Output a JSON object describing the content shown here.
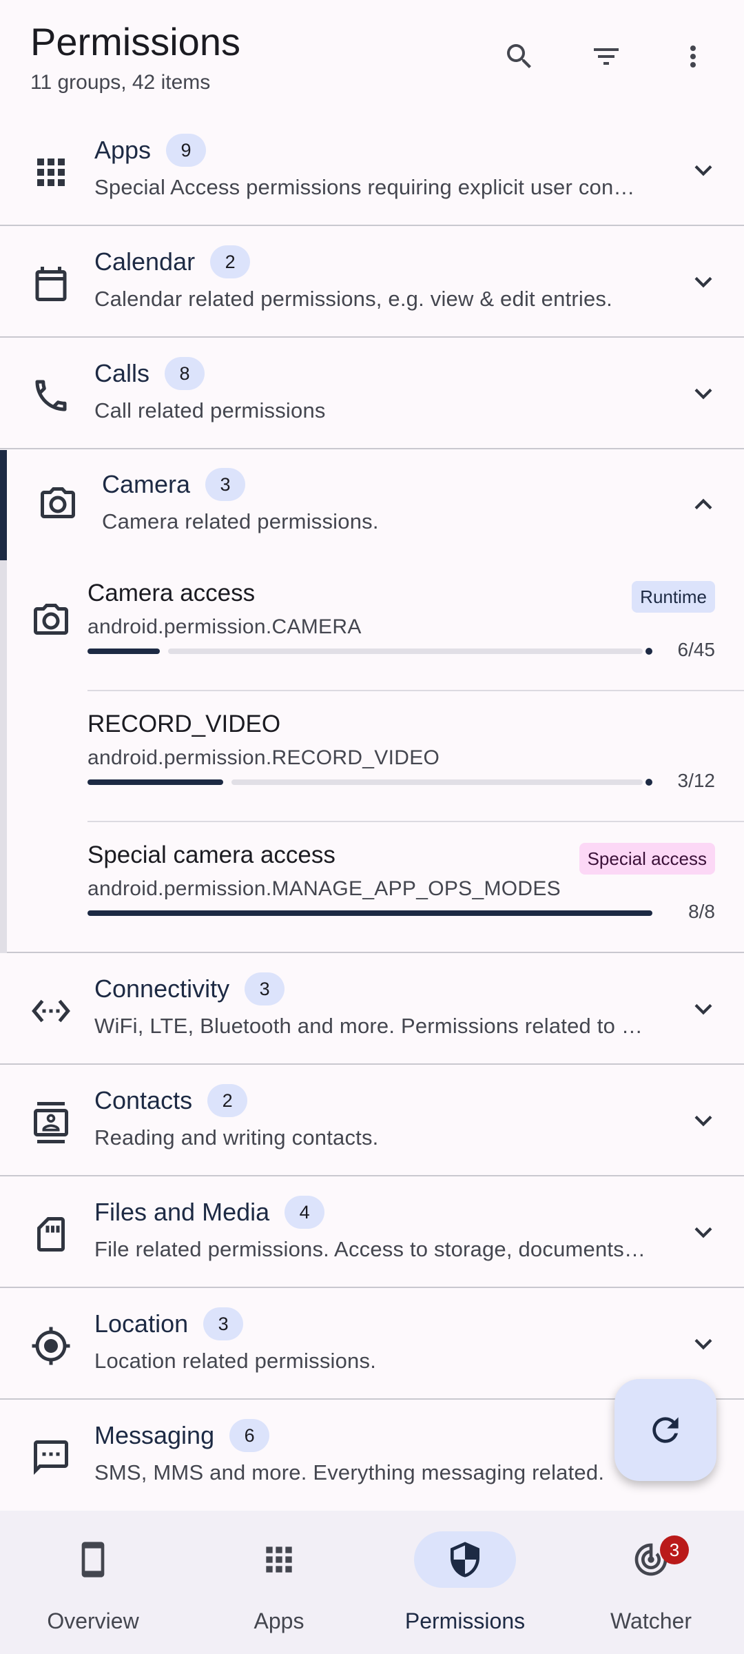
{
  "header": {
    "title": "Permissions",
    "subtitle": "11 groups, 42 items",
    "actions": [
      "search-icon",
      "filter-icon",
      "more-vert-icon"
    ]
  },
  "groups": [
    {
      "name": "Apps",
      "count": "9",
      "description": "Special Access permissions requiring explicit user consent",
      "icon": "apps-grid-icon",
      "expanded": false
    },
    {
      "name": "Calendar",
      "count": "2",
      "description": "Calendar related permissions, e.g. view & edit entries.",
      "icon": "calendar-icon",
      "expanded": false
    },
    {
      "name": "Calls",
      "count": "8",
      "description": "Call related permissions",
      "icon": "phone-icon",
      "expanded": false
    },
    {
      "name": "Camera",
      "count": "3",
      "description": "Camera related permissions.",
      "icon": "camera-icon",
      "expanded": true
    },
    {
      "name": "Connectivity",
      "count": "3",
      "description": "WiFi, LTE, Bluetooth and more. Permissions related to connectivity",
      "icon": "connectivity-icon",
      "expanded": false
    },
    {
      "name": "Contacts",
      "count": "2",
      "description": "Reading and writing contacts.",
      "icon": "contacts-icon",
      "expanded": false
    },
    {
      "name": "Files and Media",
      "count": "4",
      "description": "File related permissions. Access to storage, documents and media",
      "icon": "sd-card-icon",
      "expanded": false
    },
    {
      "name": "Location",
      "count": "3",
      "description": "Location related permissions.",
      "icon": "location-icon",
      "expanded": false
    },
    {
      "name": "Messaging",
      "count": "6",
      "description": "SMS, MMS and more. Everything messaging related.",
      "icon": "message-icon",
      "expanded": false
    }
  ],
  "camera_permissions": [
    {
      "label": "Camera access",
      "id": "android.permission.CAMERA",
      "tag": "Runtime",
      "count": "6/45",
      "granted": 6,
      "total": 45
    },
    {
      "label": "RECORD_VIDEO",
      "id": "android.permission.RECORD_VIDEO",
      "tag": "",
      "count": "3/12",
      "granted": 3,
      "total": 12
    },
    {
      "label": "Special camera access",
      "id": "android.permission.MANAGE_APP_OPS_MODES",
      "tag": "Special access",
      "count": "8/8",
      "granted": 8,
      "total": 8
    }
  ],
  "fab": {
    "icon": "refresh-icon"
  },
  "bottom_nav": {
    "items": [
      {
        "label": "Overview",
        "icon": "phone-device-icon",
        "active": false
      },
      {
        "label": "Apps",
        "icon": "apps-grid-icon",
        "active": false
      },
      {
        "label": "Permissions",
        "icon": "shield-icon",
        "active": true
      },
      {
        "label": "Watcher",
        "icon": "radar-icon",
        "active": false,
        "badge": "3"
      }
    ]
  },
  "colors": {
    "background": "#fdf9fc",
    "accent": "#1d2a44",
    "badge_bg": "#dce3fb",
    "special_tag_bg": "#fcd8f6",
    "notification_badge": "#ba1a1a"
  }
}
